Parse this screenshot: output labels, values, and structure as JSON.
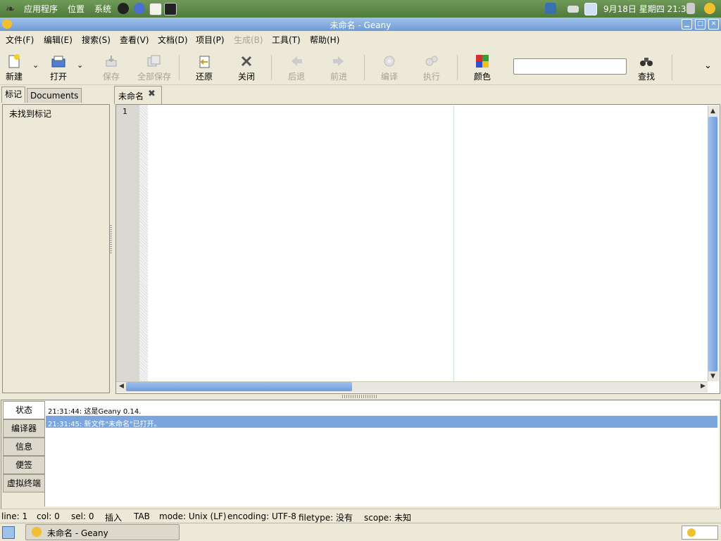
{
  "top_panel": {
    "menus": [
      "应用程序",
      "位置",
      "系统"
    ],
    "clock": "9月18日 星期四 21:32"
  },
  "window": {
    "title": "未命名 - Geany"
  },
  "menubar": {
    "items": [
      "文件(F)",
      "编辑(E)",
      "搜索(S)",
      "查看(V)",
      "文档(D)",
      "项目(P)",
      "生成(B)",
      "工具(T)",
      "帮助(H)"
    ]
  },
  "toolbar": {
    "new": "新建",
    "open": "打开",
    "save": "保存",
    "save_all": "全部保存",
    "revert": "还原",
    "close": "关闭",
    "back": "后退",
    "forward": "前进",
    "compile": "编译",
    "execute": "执行",
    "color": "颜色",
    "find": "查找",
    "search_value": ""
  },
  "sidebar": {
    "tabs": [
      "标记",
      "Documents"
    ],
    "empty_text": "未找到标记"
  },
  "editor": {
    "tab_label": "未命名",
    "line_number": "1"
  },
  "messages": {
    "tabs": [
      "状态",
      "编译器",
      "信息",
      "便签",
      "虚拟终端"
    ],
    "log": [
      "21:31:44: 这是Geany 0.14.",
      "21:31:45: 新文件\"未命名\"已打开。"
    ]
  },
  "statusbar": {
    "line": "line: 1",
    "col": "col: 0",
    "sel": "sel: 0",
    "insert": "插入",
    "tab": "TAB",
    "mode": "mode: Unix (LF)",
    "encoding": "encoding: UTF-8",
    "filetype": "filetype: 没有",
    "scope": "scope: 未知"
  },
  "taskbar": {
    "task": "未命名 - Geany"
  },
  "colors": {
    "panel": "#5a8546",
    "titlebar": "#7ba6dd",
    "selection": "#7ba6dd"
  }
}
